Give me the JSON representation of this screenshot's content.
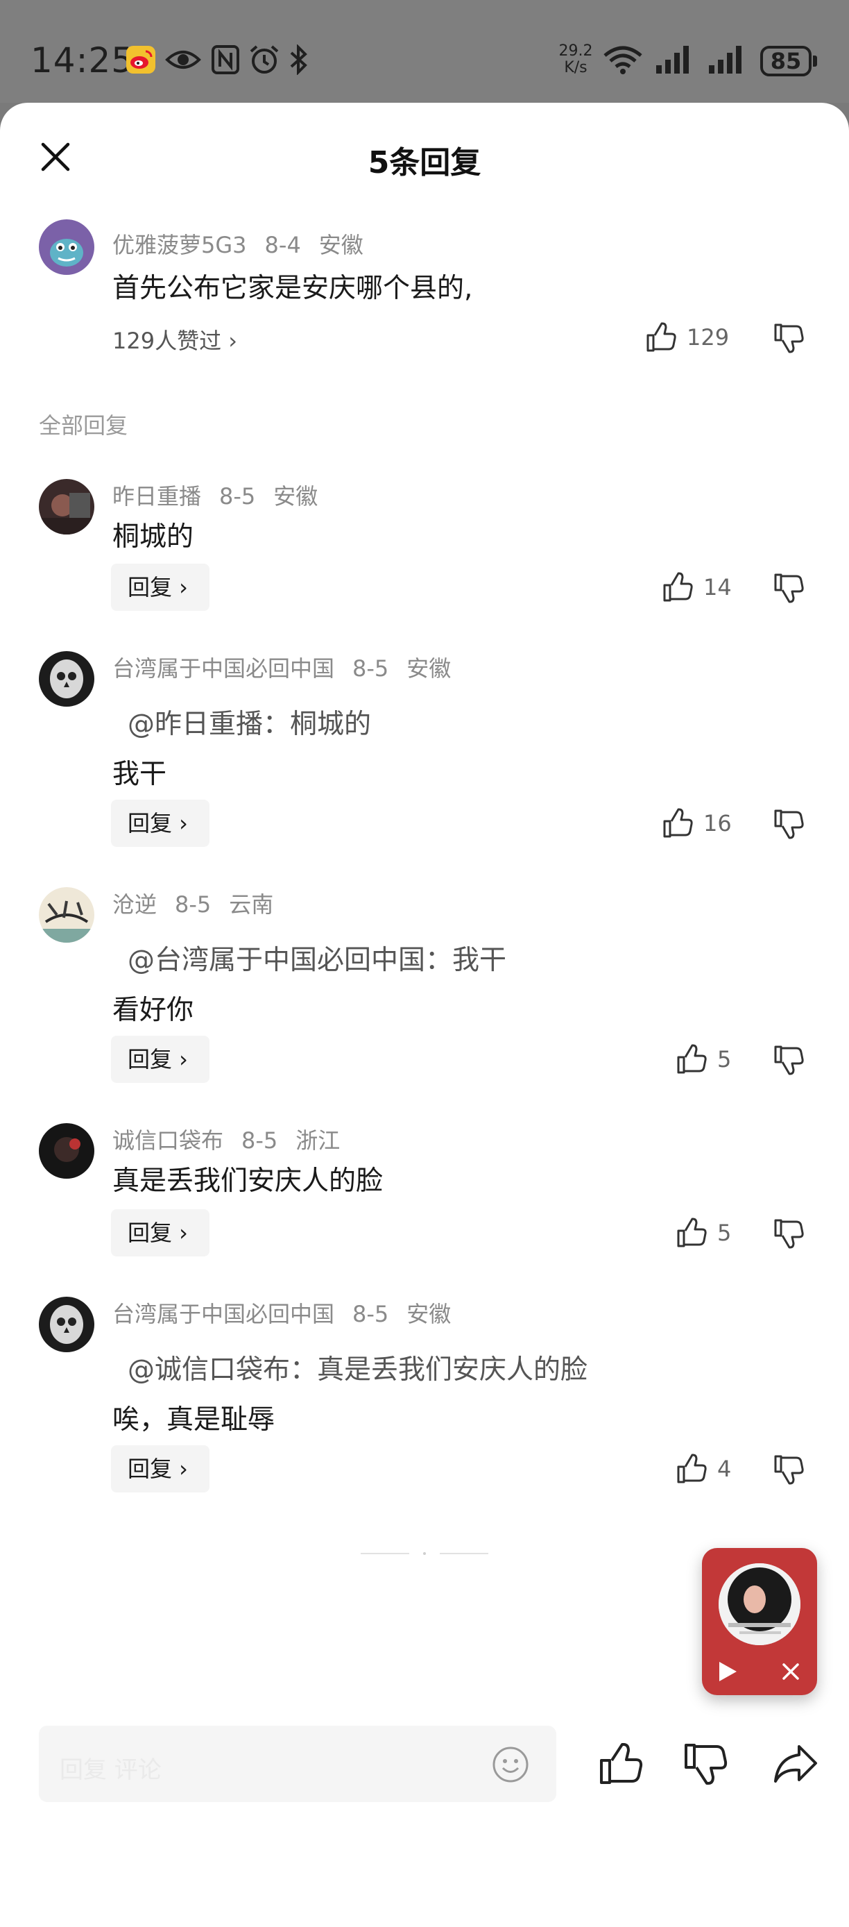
{
  "status_bar": {
    "time": "14:25",
    "net_speed_value": "29.2",
    "net_speed_unit": "K/s",
    "battery": "85",
    "icons": [
      "weibo-icon",
      "eye-icon",
      "nfc-icon",
      "alarm-icon",
      "bluetooth-icon",
      "wifi-icon",
      "signal-icon",
      "signal-icon"
    ]
  },
  "header": {
    "title": "5条回复"
  },
  "original_comment": {
    "username": "优雅菠萝5G3",
    "date": "8-4",
    "location": "安徽",
    "text": "首先公布它家是安庆哪个县的,",
    "liked_by": "129人赞过 ›",
    "like_count": "129"
  },
  "section_label": "全部回复",
  "replies": [
    {
      "username": "昨日重播",
      "date": "8-5",
      "location": "安徽",
      "quote": "",
      "text": "桐城的",
      "reply_label": "回复 ›",
      "like_count": "14"
    },
    {
      "username": "台湾属于中国必回中国",
      "date": "8-5",
      "location": "安徽",
      "quote": "@昨日重播：桐城的",
      "text": "我干",
      "reply_label": "回复 ›",
      "like_count": "16"
    },
    {
      "username": "沧逆",
      "date": "8-5",
      "location": "云南",
      "quote": "@台湾属于中国必回中国：我干",
      "text": "看好你",
      "reply_label": "回复 ›",
      "like_count": "5"
    },
    {
      "username": "诚信口袋布",
      "date": "8-5",
      "location": "浙江",
      "quote": "",
      "text": "真是丢我们安庆人的脸",
      "reply_label": "回复 ›",
      "like_count": "5"
    },
    {
      "username": "台湾属于中国必回中国",
      "date": "8-5",
      "location": "安徽",
      "quote": "@诚信口袋布：真是丢我们安庆人的脸",
      "text": "唉，真是耻辱",
      "reply_label": "回复 ›",
      "like_count": "4"
    }
  ],
  "bottom_bar": {
    "input_placeholder": "回复 评论"
  },
  "colors": {
    "status_bar_bg": "#7f7f7f",
    "sheet_bg": "#ffffff",
    "meta_gray": "#8a8a8a",
    "reply_button_bg": "#f4f4f4",
    "float_player_red": "#c23838"
  }
}
